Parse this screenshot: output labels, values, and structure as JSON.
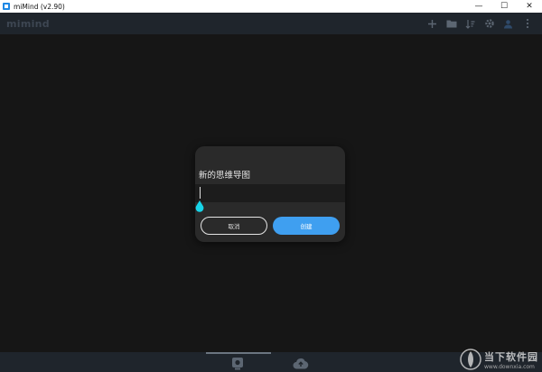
{
  "window": {
    "title": "miMind (v2.90)",
    "minimize_glyph": "—",
    "maximize_glyph": "☐",
    "close_glyph": "✕"
  },
  "toolbar": {
    "logo": "mimind",
    "icons": [
      "add-icon",
      "folder-icon",
      "sort-icon",
      "settings-icon",
      "user-icon",
      "more-vert-icon"
    ]
  },
  "dialog": {
    "title": "新的思维导图",
    "input_value": "",
    "cancel_label": "取消",
    "create_label": "创建"
  },
  "bottombar": {
    "icons": [
      "local-device-icon",
      "cloud-upload-icon"
    ]
  },
  "watermark": {
    "title": "当下软件园",
    "url": "www.downxia.com"
  },
  "colors": {
    "accent": "#3f9ff0",
    "teardrop": "#17d4e8",
    "toolbar_bg": "#1f252c",
    "canvas_bg": "#161616"
  }
}
